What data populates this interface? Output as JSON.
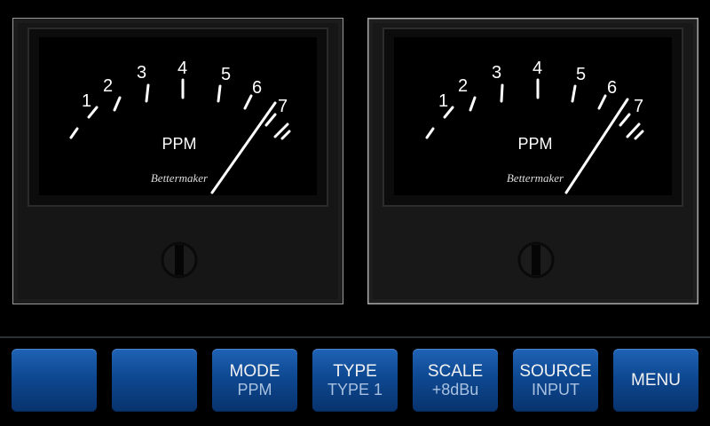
{
  "meters": [
    {
      "id": "left",
      "scale_labels": [
        "1",
        "2",
        "3",
        "4",
        "5",
        "6",
        "7"
      ],
      "unit_label": "PPM",
      "brand": "Bettermaker",
      "needle_reading": 6.6,
      "face_color": "#000000",
      "bezel_color": "#1c1c1c"
    },
    {
      "id": "right",
      "scale_labels": [
        "1",
        "2",
        "3",
        "4",
        "5",
        "6",
        "7"
      ],
      "unit_label": "PPM",
      "brand": "Bettermaker",
      "needle_reading": 6.4,
      "face_color": "#000000",
      "bezel_color": "#1e1e1e"
    }
  ],
  "buttons": [
    {
      "name": "blank-button-1",
      "line1": "",
      "line2": ""
    },
    {
      "name": "blank-button-2",
      "line1": "",
      "line2": ""
    },
    {
      "name": "mode-button",
      "line1": "MODE",
      "line2": "PPM"
    },
    {
      "name": "type-button",
      "line1": "TYPE",
      "line2": "TYPE 1"
    },
    {
      "name": "scale-button",
      "line1": "SCALE",
      "line2": "+8dBu"
    },
    {
      "name": "source-button",
      "line1": "SOURCE",
      "line2": "INPUT"
    },
    {
      "name": "menu-button",
      "label": "MENU"
    }
  ],
  "colors": {
    "button_top": "#1f63b5",
    "button_bottom": "#08336d",
    "button_text": "#f2f2f2",
    "button_subtext": "#a9c1e0",
    "needle": "#ffffff"
  }
}
